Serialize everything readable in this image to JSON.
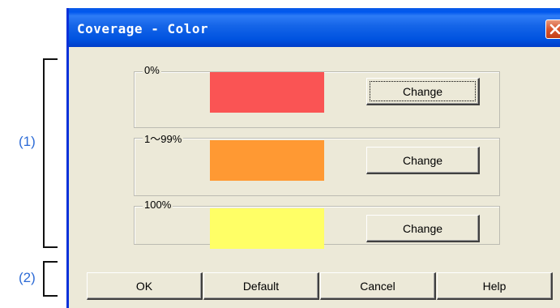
{
  "annotations": {
    "group1": "(1)",
    "group2": "(2)"
  },
  "dialog": {
    "title": "Coverage - Color"
  },
  "icons": {
    "close": "close-icon"
  },
  "colors": {
    "zero": "#fa5454",
    "partial": "#ff9933",
    "full": "#ffff66",
    "titlebar": "#0a5ae8",
    "dialog_bg": "#ece9d8"
  },
  "groups": [
    {
      "label": "0%",
      "button": "Change"
    },
    {
      "label": "1～99%",
      "button": "Change"
    },
    {
      "label": "100%",
      "button": "Change"
    }
  ],
  "footer": {
    "ok": "OK",
    "default": "Default",
    "cancel": "Cancel",
    "help": "Help"
  }
}
